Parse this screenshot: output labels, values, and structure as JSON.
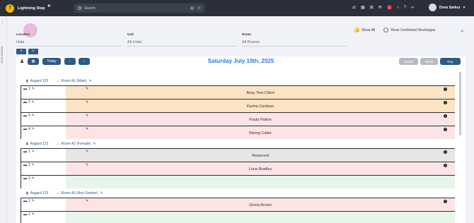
{
  "app": {
    "name": "Lightning Step",
    "logo_letter": "f"
  },
  "search": {
    "placeholder": "Search"
  },
  "notifications": {
    "count": "1"
  },
  "user": {
    "name": "Drew Sarkez"
  },
  "rail": {
    "label": "DASHBOARD"
  },
  "filters": {
    "location": {
      "label": "Location",
      "value": "Hala"
    },
    "unit": {
      "label": "Unit",
      "value": "All Units"
    },
    "room": {
      "label": "Room",
      "value": "All Rooms"
    },
    "show_all": "Show All",
    "show_confirmed": "Show Confirmed Discharges"
  },
  "calendar": {
    "today": "Today",
    "date": "Saturday July 19th, 2025",
    "views": {
      "month": "Month",
      "week": "Week",
      "day": "Day"
    }
  },
  "rooms": [
    {
      "facility": "Asgard 123",
      "room": "Room A1 (Male)",
      "beds": [
        {
          "num": "1",
          "occupant": "Busy Test Client",
          "color": "#fbe3c4"
        },
        {
          "num": "2",
          "occupant": "Karina Cardoso",
          "color": "#fbe3c4"
        },
        {
          "num": "3",
          "occupant": "Paula Patton",
          "color": "#fde4e4"
        },
        {
          "num": "4",
          "occupant": "Mising Caller",
          "color": "#fde4e4"
        }
      ]
    },
    {
      "facility": "Asgard 123",
      "room": "Room A2 (Female)",
      "beds": [
        {
          "num": "1",
          "occupant": "Reserved",
          "color": "#e6e6e6"
        },
        {
          "num": "2",
          "occupant": "Lena Bradley",
          "color": "#fde4e4"
        },
        {
          "num": "3",
          "occupant": "",
          "color": "#e6f6ea"
        }
      ]
    },
    {
      "facility": "Asgard 123",
      "room": "Room A3 (Any Gender)",
      "beds": [
        {
          "num": "1",
          "occupant": "Gloria Brown",
          "color": "#fde4e4"
        },
        {
          "num": "2",
          "occupant": "",
          "color": "#e6f6ea"
        }
      ]
    }
  ]
}
